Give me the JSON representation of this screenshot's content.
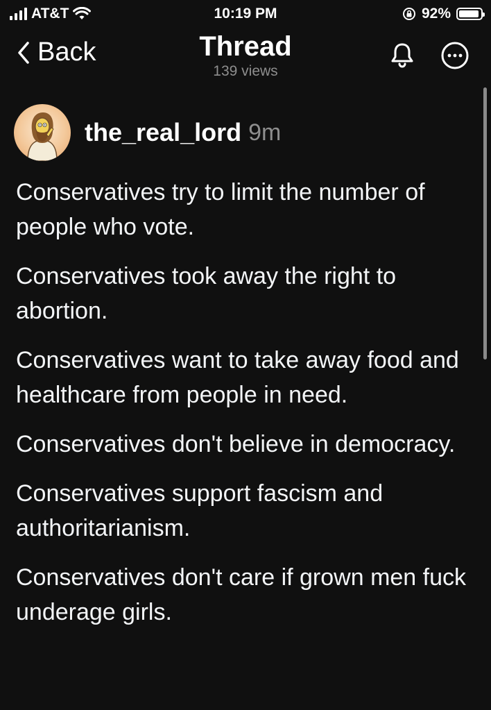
{
  "status_bar": {
    "carrier": "AT&T",
    "time": "10:19 PM",
    "battery_percent": "92%",
    "battery_level": 0.92,
    "signal_icon": "signal-bars-icon",
    "wifi_icon": "wifi-icon",
    "orientation_lock_icon": "orientation-lock-icon"
  },
  "header": {
    "back_label": "Back",
    "title": "Thread",
    "views": "139 views",
    "icons": [
      "chevron-left-icon",
      "bell-icon",
      "more-options-icon"
    ]
  },
  "post": {
    "username": "the_real_lord",
    "timestamp": "9m",
    "paragraphs": [
      "Conservatives try to limit the number of people who vote.",
      "Conservatives took away the right to abortion.",
      "Conservatives want to take away food and healthcare from people in need.",
      "Conservatives don't believe in democracy.",
      "Conservatives support fascism and authoritarianism.",
      "Conservatives don't care if grown men fuck underage girls."
    ]
  },
  "colors": {
    "background": "#101010",
    "text_primary": "#f3f5f7",
    "text_secondary": "#8e8e8e"
  }
}
